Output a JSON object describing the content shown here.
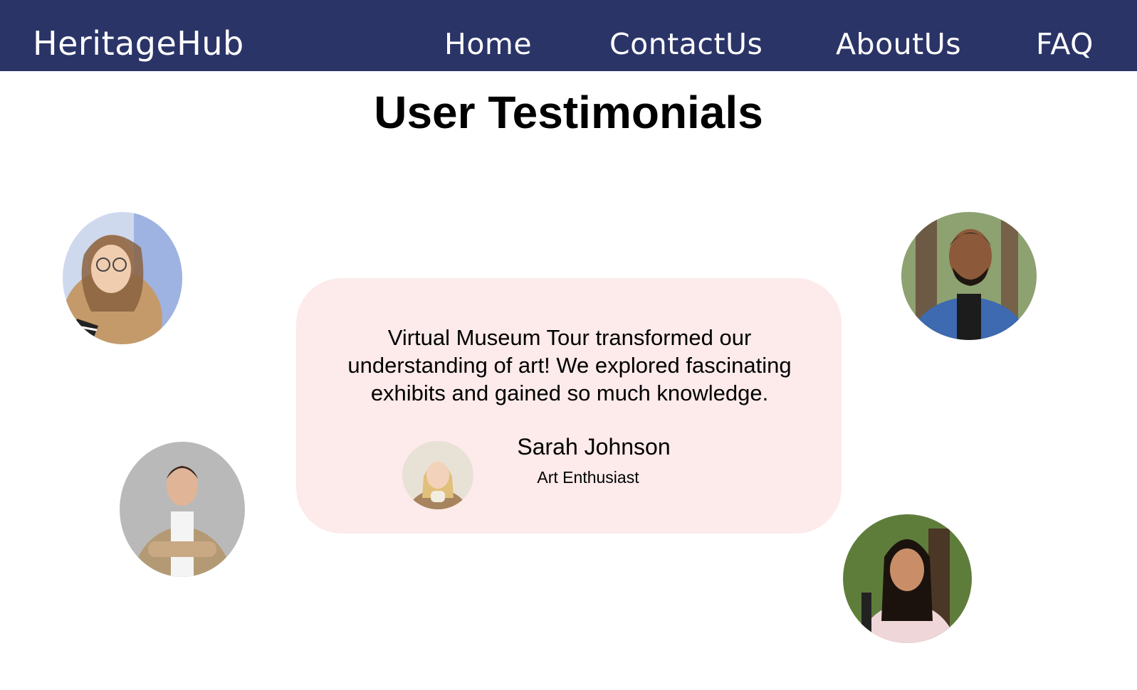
{
  "nav": {
    "brand": "HeritageHub",
    "links": [
      "Home",
      "ContactUs",
      "AboutUs",
      "FAQ"
    ]
  },
  "page": {
    "title": "User Testimonials"
  },
  "testimonial": {
    "quote": "Virtual Museum Tour transformed our understanding of art! We explored fascinating exhibits and gained so much knowledge.",
    "author_name": "Sarah Johnson",
    "author_role": "Art Enthusiast"
  },
  "colors": {
    "navbar": "#2b3467",
    "card": "#fdeaea"
  }
}
